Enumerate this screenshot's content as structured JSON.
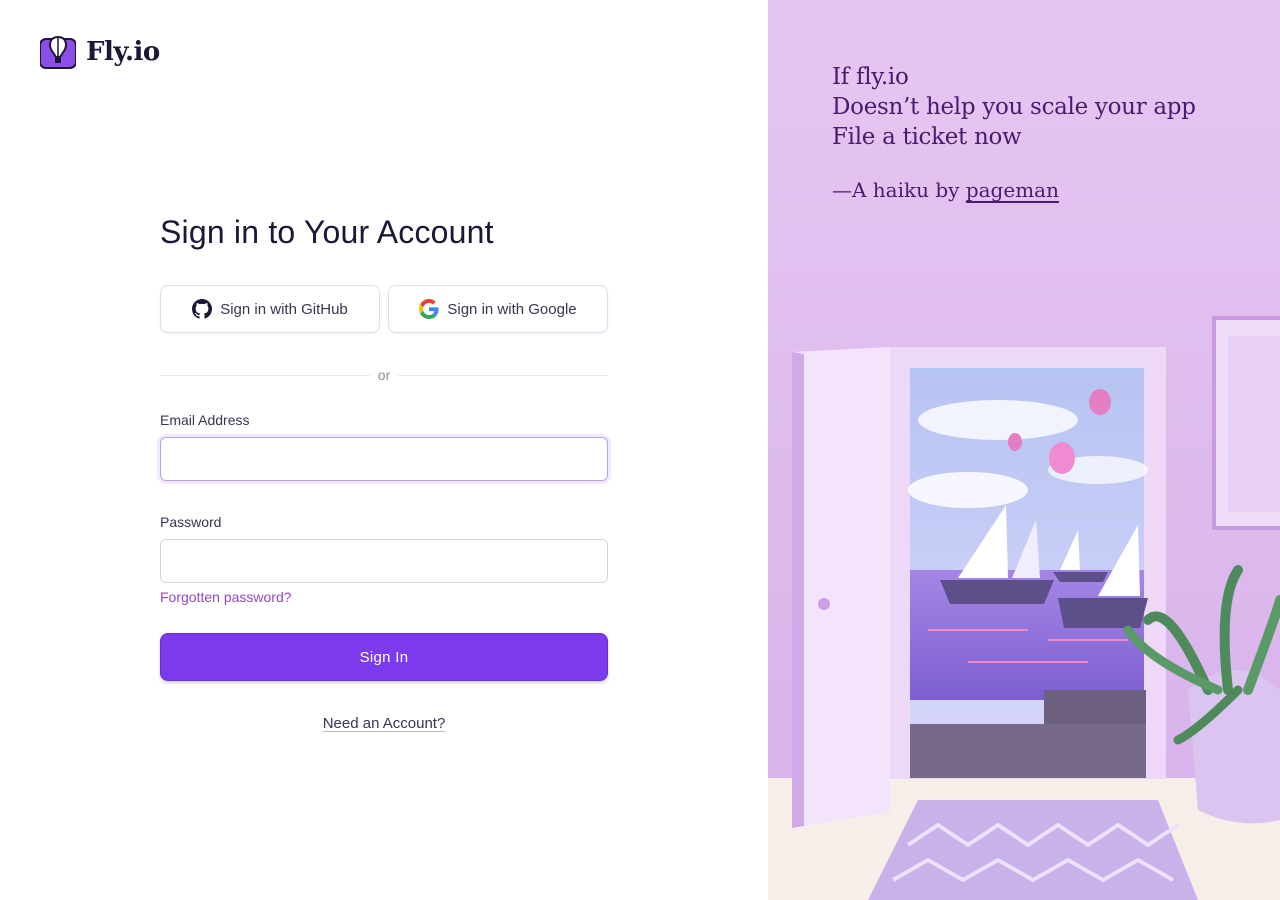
{
  "brand": {
    "name": "Fly.io",
    "accent": "#7b3aec"
  },
  "form": {
    "title": "Sign in to Your Account",
    "github_button": "Sign in with GitHub",
    "google_button": "Sign in with Google",
    "divider_text": "or",
    "email_label": "Email Address",
    "email_value": "",
    "password_label": "Password",
    "password_value": "",
    "forgot_link": "Forgotten password?",
    "submit_label": "Sign In",
    "signup_link": "Need an Account?"
  },
  "haiku": {
    "lines": [
      "If fly.io",
      "Doesn’t help you scale your app",
      "File a ticket now"
    ],
    "credit_prefix": "—A haiku by ",
    "author": "pageman"
  },
  "icons": {
    "github": "github-icon",
    "google": "google-icon",
    "logo": "balloon-logo-icon"
  }
}
